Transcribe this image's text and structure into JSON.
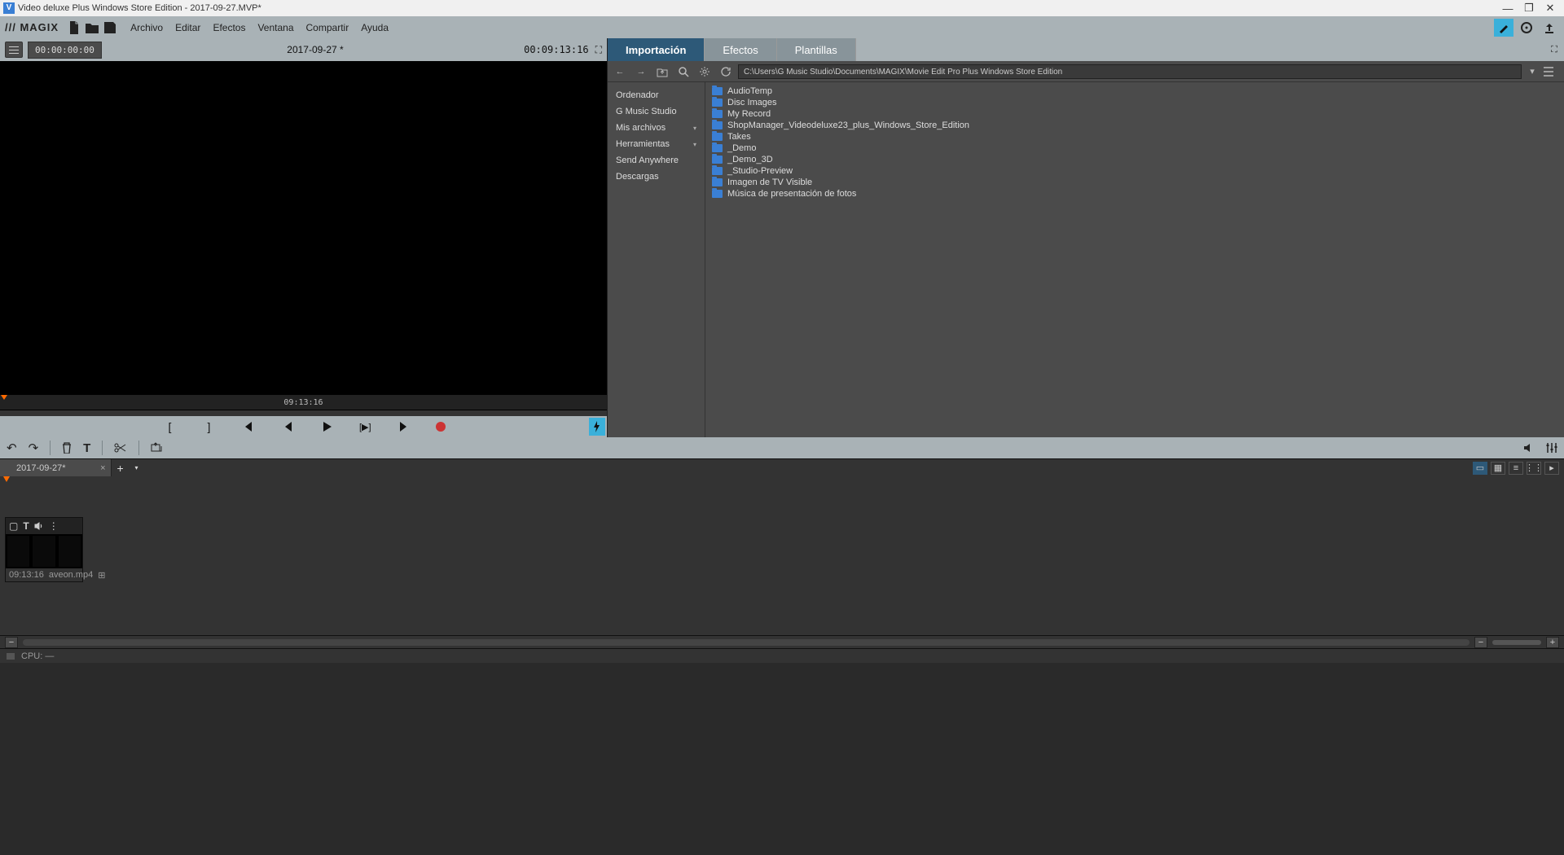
{
  "title_bar": {
    "title": "Video deluxe Plus Windows Store Edition - 2017-09-27.MVP*",
    "app_icon_letter": "V"
  },
  "brand": "/// MAGIX",
  "menu": {
    "items": [
      "Archivo",
      "Editar",
      "Efectos",
      "Ventana",
      "Compartir",
      "Ayuda"
    ]
  },
  "preview": {
    "timecode": "00:00:00:00",
    "filename": "2017-09-27 *",
    "duration": "00:09:13:16",
    "mini_duration": "09:13:16"
  },
  "right_tabs": [
    "Importación",
    "Efectos",
    "Plantillas"
  ],
  "nav_path": "C:\\Users\\G Music Studio\\Documents\\MAGIX\\Movie Edit Pro Plus Windows Store Edition",
  "sidebar_items": [
    {
      "label": "Ordenador",
      "chev": false
    },
    {
      "label": "G Music Studio",
      "chev": false
    },
    {
      "label": "Mis archivos",
      "chev": true
    },
    {
      "label": "Herramientas",
      "chev": true
    },
    {
      "label": "Send Anywhere",
      "chev": false
    },
    {
      "label": "Descargas",
      "chev": false
    }
  ],
  "folders": [
    "AudioTemp",
    "Disc Images",
    "My Record",
    "ShopManager_Videodeluxe23_plus_Windows_Store_Edition",
    "Takes",
    "_Demo",
    "_Demo_3D",
    "_Studio-Preview",
    "Imagen de TV Visible",
    "Música de presentación de fotos"
  ],
  "sequence_tab": "2017-09-27*",
  "clip": {
    "duration": "09:13:16",
    "name": "aveon.mp4"
  },
  "status": {
    "cpu_label": "CPU: —"
  }
}
